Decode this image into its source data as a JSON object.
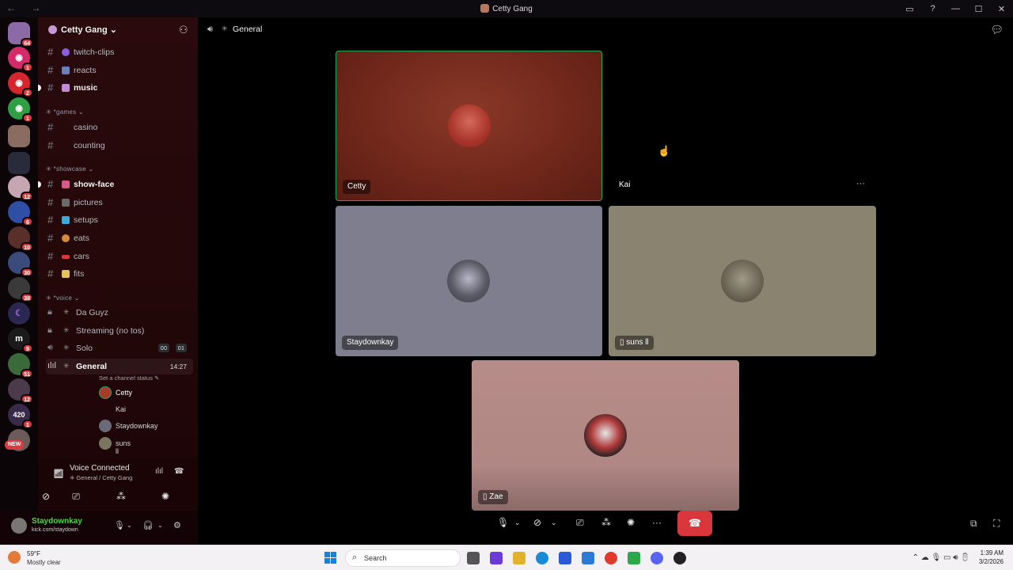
{
  "window": {
    "title": "Cetty Gang",
    "nav": "←  →"
  },
  "rail": {
    "badges": [
      "64",
      "1",
      "2",
      "1",
      "12",
      "6",
      "10",
      "30",
      "38",
      "9",
      "51",
      "12",
      "1"
    ],
    "new_label": "NEW",
    "m_glyph": "m",
    "glyph_420": "420"
  },
  "guild": {
    "name": "Cetty Gang"
  },
  "channels": {
    "text_top": [
      {
        "name": "twitch-clips"
      },
      {
        "name": "reacts"
      },
      {
        "name": "music"
      }
    ],
    "cat_games": "*games",
    "games": [
      {
        "name": "casino"
      },
      {
        "name": "counting"
      }
    ],
    "cat_showcase": "*showcase",
    "showcase": [
      {
        "name": "show-face"
      },
      {
        "name": "pictures"
      },
      {
        "name": "setups"
      },
      {
        "name": "eats"
      },
      {
        "name": "cars"
      },
      {
        "name": "fits"
      }
    ],
    "cat_voice": "*voice",
    "voice": [
      {
        "name": "Da Guyz"
      },
      {
        "name": "Streaming (no tos)"
      },
      {
        "name": "Solo",
        "users": "00",
        "limit": "01"
      },
      {
        "name": "General",
        "time": "14:27"
      }
    ],
    "set_status": "Set a channel status",
    "members": [
      "Cetty",
      "Kai",
      "Staydownkay",
      "suns ll"
    ]
  },
  "voice_panel": {
    "title": "Voice Connected",
    "subtitle": "General / Cetty Gang"
  },
  "user": {
    "name": "Staydownkay",
    "status": "kick.com/staydown"
  },
  "main": {
    "channel": "General",
    "tiles": {
      "cetty": "Cetty",
      "kai": "Kai",
      "staydownkay": "Staydownkay",
      "suns": "suns ll",
      "zae": "Zae"
    }
  },
  "taskbar": {
    "temp": "59°F",
    "condition": "Mostly clear",
    "search": "Search",
    "time": "1:39 AM",
    "date": "3/2/2026"
  },
  "colors": {
    "accent_red": "#da373c",
    "tile_cetty": "#7a2a1f",
    "tile_stay": "#7e7e8e",
    "tile_suns": "#8a836f",
    "tile_zae": "#b78c88"
  }
}
